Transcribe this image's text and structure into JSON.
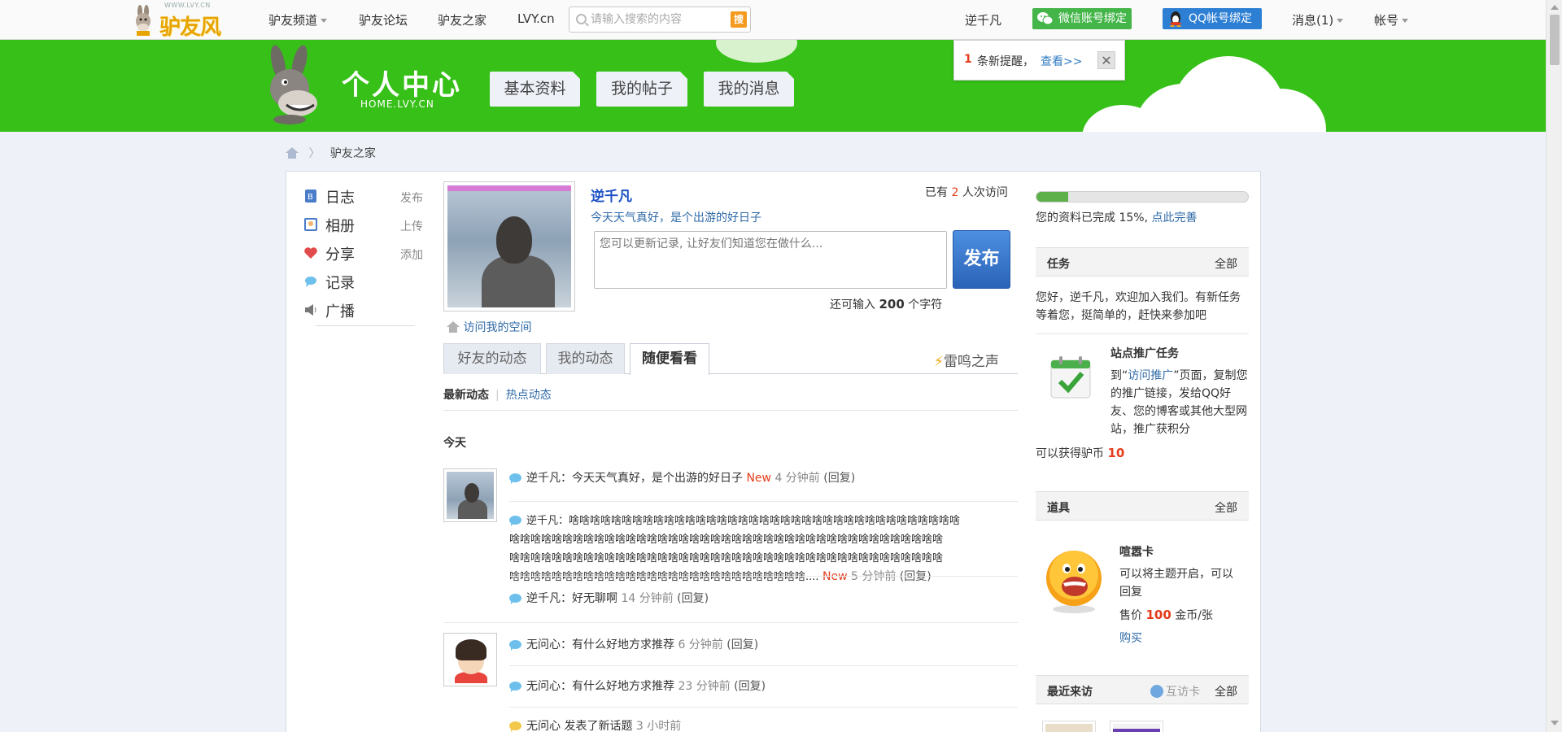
{
  "topbar": {
    "logo_url_text": "WWW.LVY.CN",
    "logo_text": "驴友风",
    "nav": [
      "驴友频道",
      "驴友论坛",
      "驴友之家",
      "LVY.cn"
    ],
    "search_placeholder": "请输入搜索的内容",
    "search_button": "搜",
    "user": "逆千凡",
    "wechat_bind": "微信账号绑定",
    "qq_bind": "QQ帐号绑定",
    "messages": "消息(1)",
    "account": "帐号"
  },
  "banner": {
    "title": "个人中心",
    "subtitle": "HOME.LVY.CN",
    "tabs": [
      "基本资料",
      "我的帖子",
      "我的消息"
    ],
    "bg_color": "#36c018"
  },
  "notification": {
    "count": "1",
    "text": "条新提醒，",
    "link": "查看>>",
    "close": "✕"
  },
  "breadcrumb": {
    "current": "驴友之家"
  },
  "sidebar": {
    "items": [
      {
        "label": "日志",
        "action": "发布",
        "icon": "blog-icon"
      },
      {
        "label": "相册",
        "action": "上传",
        "icon": "album-icon"
      },
      {
        "label": "分享",
        "action": "添加",
        "icon": "share-icon"
      },
      {
        "label": "记录",
        "action": "",
        "icon": "record-icon"
      },
      {
        "label": "广播",
        "action": "",
        "icon": "broadcast-icon"
      }
    ]
  },
  "profile": {
    "name": "逆千凡",
    "status": "今天天气真好，是个出游的好日子",
    "visits_prefix": "已有",
    "visits_count": "2",
    "visits_suffix": "人次访问",
    "post_placeholder": "您可以更新记录, 让好友们知道您在做什么...",
    "publish_button": "发布",
    "char_prefix": "还可输入",
    "char_count": "200",
    "char_suffix": "个字符",
    "visit_space": "访问我的空间"
  },
  "feed": {
    "tabs": [
      "好友的动态",
      "我的动态",
      "随便看看"
    ],
    "active_tab": "随便看看",
    "thunder": "雷鸣之声",
    "subtabs_current": "最新动态",
    "subtabs_other": "热点动态",
    "day_label": "今天",
    "entries": [
      {
        "text": "逆千凡：今天天气真好，是个出游的好日子",
        "new": "New",
        "time": "4 分钟前",
        "reply": "(回复)"
      },
      {
        "text_line1": "逆千凡：啥啥啥啥啥啥啥啥啥啥啥啥啥啥啥啥啥啥啥啥啥啥啥啥啥啥啥啥啥啥啥啥啥啥啥啥啥",
        "text_line2": "啥啥啥啥啥啥啥啥啥啥啥啥啥啥啥啥啥啥啥啥啥啥啥啥啥啥啥啥啥啥啥啥啥啥啥啥啥啥啥啥啥",
        "text_line3": "啥啥啥啥啥啥啥啥啥啥啥啥啥啥啥啥啥啥啥啥啥啥啥啥啥啥啥啥啥啥啥啥啥啥啥啥啥啥啥啥啥",
        "text_line4": "啥啥啥啥啥啥啥啥啥啥啥啥啥啥啥啥啥啥啥啥啥啥啥啥啥啥啥啥....",
        "new": "New",
        "time": "5 分钟前",
        "reply": "(回复)"
      },
      {
        "text": "逆千凡：好无聊啊",
        "time": "14 分钟前",
        "reply": "(回复)"
      },
      {
        "text": "无问心：有什么好地方求推荐",
        "time": "6 分钟前",
        "reply": "(回复)"
      },
      {
        "text": "无问心：有什么好地方求推荐",
        "time": "23 分钟前",
        "reply": "(回复)"
      },
      {
        "text": "无问心 发表了新话题",
        "time": "3 小时前"
      }
    ]
  },
  "right": {
    "progress_fraction": 0.15,
    "progress_text": "您的资料已完成 15%,",
    "progress_link": "点此完善",
    "tasks_title": "任务",
    "tasks_all": "全部",
    "tasks_welcome": "您好，逆千凡，欢迎加入我们。有新任务等着您，挺简单的，赶快来参加吧",
    "task_name": "站点推广任务",
    "task_desc_pre": "到“",
    "task_desc_link": "访问推广",
    "task_desc_post": "”页面，复制您的推广链接，发给QQ好友、您的博客或其他大型网站，推广获积分",
    "task_reward_pre": "可以获得驴币",
    "task_reward_value": "10",
    "props_title": "道具",
    "props_all": "全部",
    "prop_name": "喧嚣卡",
    "prop_desc": "可以将主题开启，可以回复",
    "prop_price_pre": "售价",
    "prop_price_value": "100",
    "prop_price_post": "金币/张",
    "prop_buy": "购买",
    "visitors_title": "最近来访",
    "visitors_mutual": "互访卡",
    "visitors_all": "全部"
  }
}
